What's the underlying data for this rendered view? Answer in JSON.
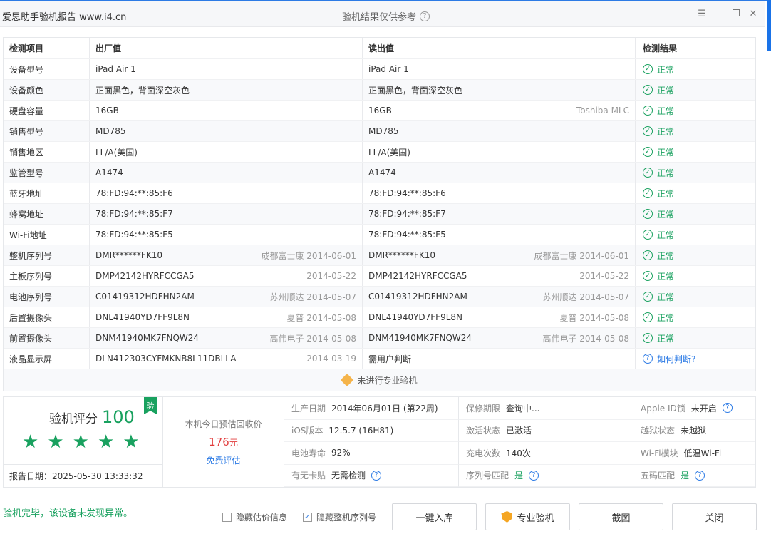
{
  "window": {
    "title": "爱思助手验机报告 www.i4.cn",
    "center_text": "验机结果仅供参考"
  },
  "table": {
    "headers": [
      "检测项目",
      "出厂值",
      "读出值",
      "检测结果"
    ],
    "rows": [
      {
        "item": "设备型号",
        "factory": "iPad Air 1",
        "factory_note": "",
        "read": "iPad Air 1",
        "read_note": "",
        "result": "正常"
      },
      {
        "item": "设备颜色",
        "factory": "正面黑色，背面深空灰色",
        "factory_note": "",
        "read": "正面黑色，背面深空灰色",
        "read_note": "",
        "result": "正常"
      },
      {
        "item": "硬盘容量",
        "factory": "16GB",
        "factory_note": "",
        "read": "16GB",
        "read_note": "Toshiba MLC",
        "result": "正常"
      },
      {
        "item": "销售型号",
        "factory": "MD785",
        "factory_note": "",
        "read": "MD785",
        "read_note": "",
        "result": "正常"
      },
      {
        "item": "销售地区",
        "factory": "LL/A(美国)",
        "factory_note": "",
        "read": "LL/A(美国)",
        "read_note": "",
        "result": "正常"
      },
      {
        "item": "监管型号",
        "factory": "A1474",
        "factory_note": "",
        "read": "A1474",
        "read_note": "",
        "result": "正常"
      },
      {
        "item": "蓝牙地址",
        "factory": "78:FD:94:**:85:F6",
        "factory_note": "",
        "read": "78:FD:94:**:85:F6",
        "read_note": "",
        "result": "正常"
      },
      {
        "item": "蜂窝地址",
        "factory": "78:FD:94:**:85:F7",
        "factory_note": "",
        "read": "78:FD:94:**:85:F7",
        "read_note": "",
        "result": "正常"
      },
      {
        "item": "Wi-Fi地址",
        "factory": "78:FD:94:**:85:F5",
        "factory_note": "",
        "read": "78:FD:94:**:85:F5",
        "read_note": "",
        "result": "正常"
      },
      {
        "item": "整机序列号",
        "factory": "DMR******FK10",
        "factory_note": "成都富士康 2014-06-01",
        "read": "DMR******FK10",
        "read_note": "成都富士康 2014-06-01",
        "result": "正常"
      },
      {
        "item": "主板序列号",
        "factory": "DMP42142HYRFCCGA5",
        "factory_note": "2014-05-22",
        "read": "DMP42142HYRFCCGA5",
        "read_note": "2014-05-22",
        "result": "正常"
      },
      {
        "item": "电池序列号",
        "factory": "C01419312HDFHN2AM",
        "factory_note": "苏州顺达 2014-05-07",
        "read": "C01419312HDFHN2AM",
        "read_note": "苏州顺达 2014-05-07",
        "result": "正常"
      },
      {
        "item": "后置摄像头",
        "factory": "DNL41940YD7FF9L8N",
        "factory_note": "夏普 2014-05-08",
        "read": "DNL41940YD7FF9L8N",
        "read_note": "夏普 2014-05-08",
        "result": "正常"
      },
      {
        "item": "前置摄像头",
        "factory": "DNM41940MK7FNQW24",
        "factory_note": "高伟电子 2014-05-08",
        "read": "DNM41940MK7FNQW24",
        "read_note": "高伟电子 2014-05-08",
        "result": "正常"
      },
      {
        "item": "液晶显示屏",
        "factory": "DLN412303CYFMKNB8L11DBLLA",
        "factory_note": "2014-03-19",
        "read": "需用户判断",
        "read_note": "",
        "result": "如何判断?"
      }
    ],
    "pro_check": "未进行专业验机"
  },
  "summary": {
    "score_label": "验机评分",
    "score": "100",
    "badge": "验",
    "report_date": "报告日期：2025-05-30 13:33:32",
    "price_label": "本机今日预估回收价",
    "price": "176",
    "price_unit": "元",
    "price_link": "免费评估",
    "info": [
      {
        "k": "生产日期",
        "v": "2014年06月01日 (第22周)"
      },
      {
        "k": "保修期限",
        "v": "查询中..."
      },
      {
        "k": "Apple ID锁",
        "v": "未开启"
      },
      {
        "k": "iOS版本",
        "v": "12.5.7 (16H81)"
      },
      {
        "k": "激活状态",
        "v": "已激活"
      },
      {
        "k": "越狱状态",
        "v": "未越狱"
      },
      {
        "k": "电池寿命",
        "v": "92%"
      },
      {
        "k": "充电次数",
        "v": "140次"
      },
      {
        "k": "Wi-Fi模块",
        "v": "低温Wi-Fi"
      },
      {
        "k": "有无卡贴",
        "v": "无需检测"
      },
      {
        "k": "序列号匹配",
        "v": "是"
      },
      {
        "k": "五码匹配",
        "v": "是"
      }
    ]
  },
  "footer": {
    "message": "验机完毕，该设备未发现异常。",
    "hide_price": "隐藏估价信息",
    "hide_serial": "隐藏整机序列号",
    "btn_store": "一键入库",
    "btn_pro": "专业验机",
    "btn_screenshot": "截图",
    "btn_close": "关闭"
  },
  "colors": {
    "accent": "#2d7be5",
    "ok": "#19a15f",
    "price": "#e23c3c"
  }
}
